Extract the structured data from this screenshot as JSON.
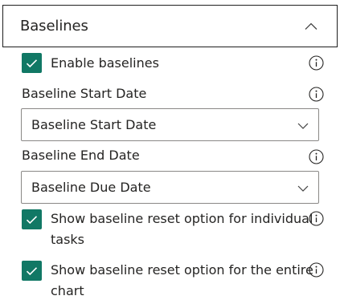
{
  "section": {
    "title": "Baselines",
    "expanded": true,
    "chevron_icon": "chevron-up-icon"
  },
  "enable_baselines": {
    "label": "Enable baselines",
    "checked": true
  },
  "start_date": {
    "label": "Baseline Start Date",
    "value": "Baseline Start Date"
  },
  "end_date": {
    "label": "Baseline End Date",
    "value": "Baseline Due Date"
  },
  "reset_individual": {
    "label": "Show baseline reset option for individual tasks",
    "checked": true
  },
  "reset_entire": {
    "label": "Show baseline reset option for the entire chart",
    "checked": true
  },
  "colors": {
    "checkbox": "#117865",
    "text": "#252423",
    "border": "#8a8886"
  },
  "icons": {
    "info": "info-circle-icon",
    "check": "checkmark-icon",
    "dropdown": "chevron-down-icon"
  }
}
